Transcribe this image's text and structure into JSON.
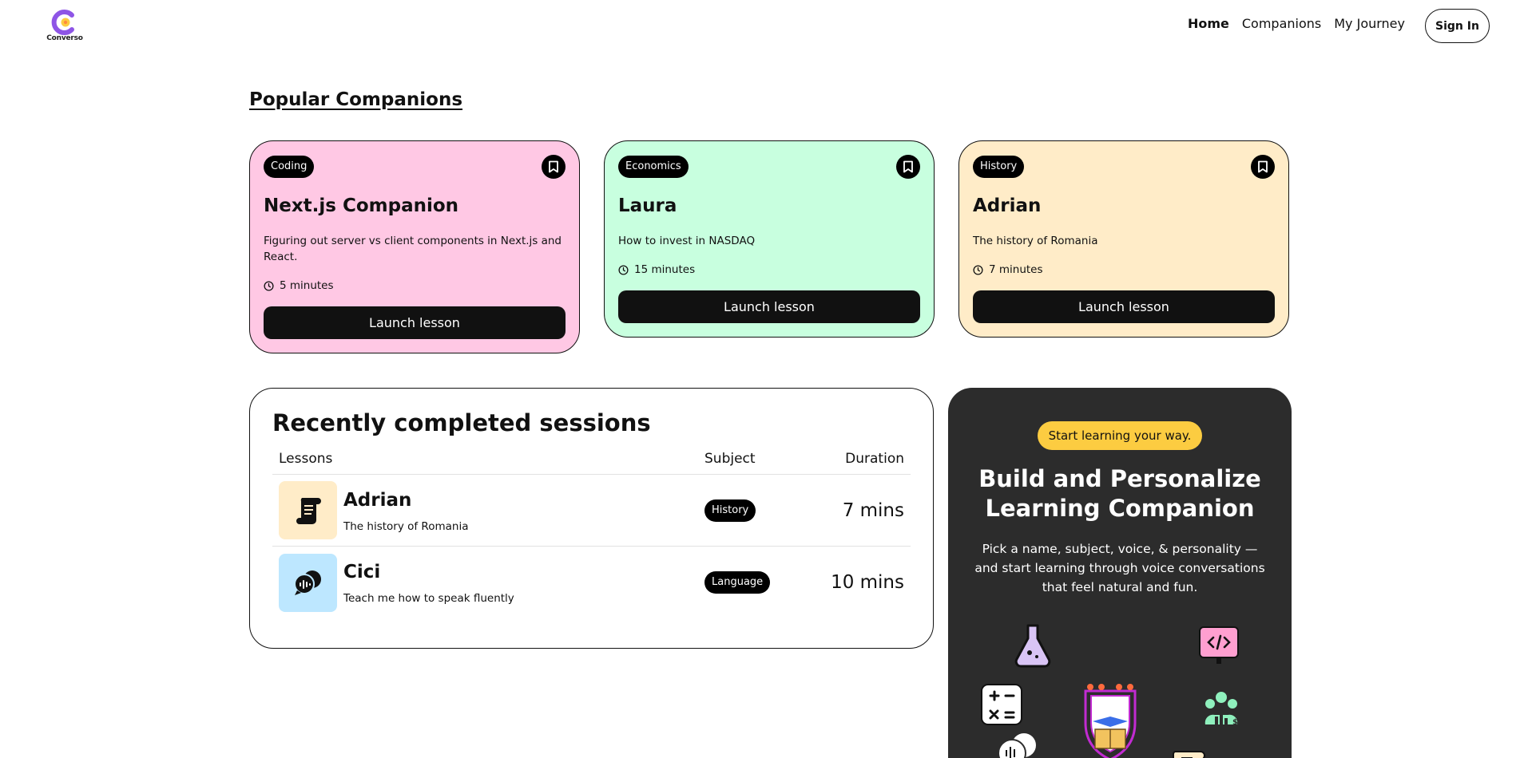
{
  "nav": {
    "logo_text": "Converso",
    "links": [
      "Home",
      "Companions",
      "My Journey"
    ],
    "sign_in": "Sign In"
  },
  "popular": {
    "title": "Popular Companions",
    "cards": [
      {
        "subject": "Coding",
        "name": "Next.js Companion",
        "topic": "Figuring out server vs client components in Next.js and React.",
        "duration": "5 minutes",
        "button": "Launch lesson",
        "color": "#ffc8e4"
      },
      {
        "subject": "Economics",
        "name": "Laura",
        "topic": "How to invest in NASDAQ",
        "duration": "15 minutes",
        "button": "Launch lesson",
        "color": "#c8ffdf"
      },
      {
        "subject": "History",
        "name": "Adrian",
        "topic": "The history of Romania",
        "duration": "7 minutes",
        "button": "Launch lesson",
        "color": "#ffecc8"
      }
    ]
  },
  "recent": {
    "title": "Recently completed sessions",
    "headers": {
      "lessons": "Lessons",
      "subject": "Subject",
      "duration": "Duration"
    },
    "rows": [
      {
        "name": "Adrian",
        "topic": "The history of Romania",
        "subject": "History",
        "duration": "7 mins",
        "color": "#ffecc8",
        "icon": "scroll-icon"
      },
      {
        "name": "Cici",
        "topic": "Teach me how to speak fluently",
        "subject": "Language",
        "duration": "10 mins",
        "color": "#bde7ff",
        "icon": "speech-bubbles-icon"
      }
    ]
  },
  "cta": {
    "pill": "Start learning your way.",
    "title": "Build and Personalize Learning Companion",
    "description": "Pick a name, subject, voice, & personality — and start learning through voice conversations that feel natural and fun."
  }
}
